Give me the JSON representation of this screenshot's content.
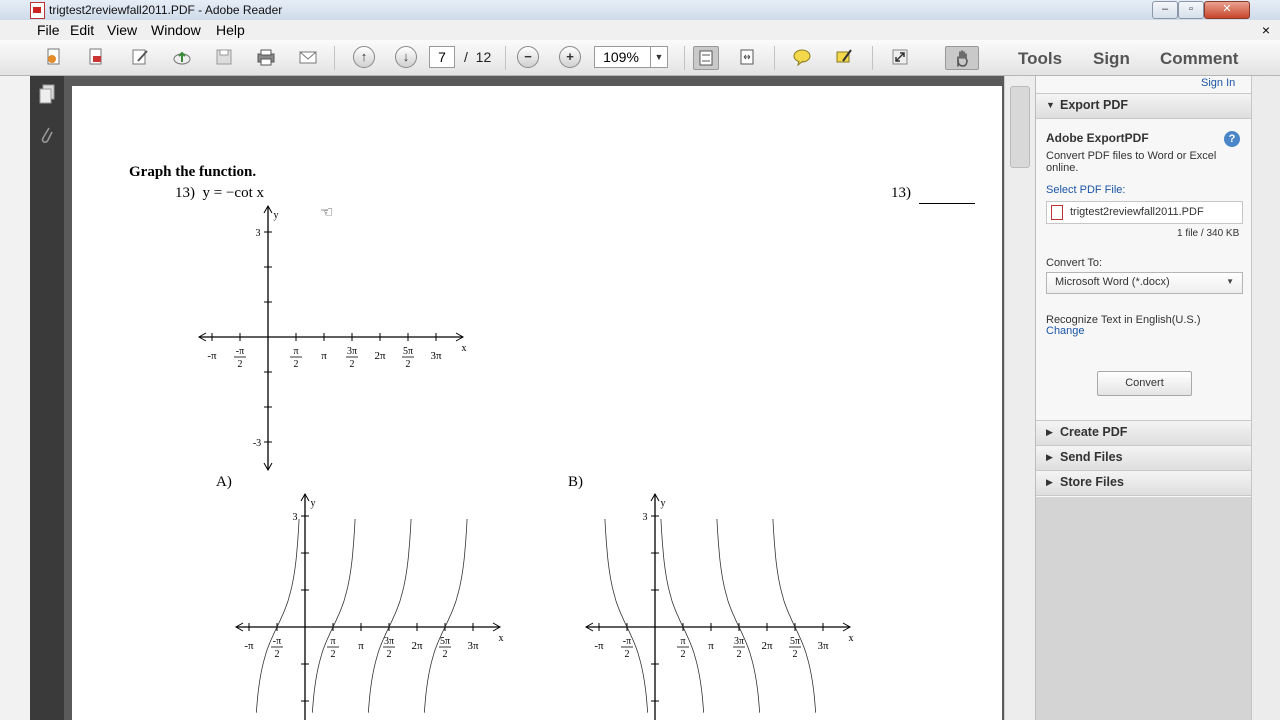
{
  "window": {
    "title": "trigtest2reviewfall2011.PDF - Adobe Reader"
  },
  "menu": {
    "items": [
      "File",
      "Edit",
      "View",
      "Window",
      "Help"
    ],
    "close_glyph": "×"
  },
  "toolbar": {
    "current_page": "7",
    "page_separator": "/",
    "total_pages": "12",
    "zoom": "109%",
    "tools_label": "Tools",
    "sign_label": "Sign",
    "comment_label": "Comment"
  },
  "document": {
    "heading": "Graph the function.",
    "question_number": "13)",
    "question_expr": "y = −cot x",
    "answer_number": "13)",
    "option_a": "A)",
    "option_b": "B)"
  },
  "axis_labels": {
    "x": "x",
    "y": "y",
    "y_top": "3",
    "y_bottom": "-3",
    "neg_pi": "-π",
    "neg_pi_num": "-π",
    "pi_num": "π",
    "pi": "π",
    "three_pi_num": "3π",
    "two_pi": "2π",
    "five_pi_num": "5π",
    "three_pi": "3π",
    "den": "2"
  },
  "right_panel": {
    "sign_in": "Sign In",
    "export_title": "Export PDF",
    "export_subtitle": "Adobe ExportPDF",
    "export_desc_1": "Convert PDF files to Word or Excel",
    "export_desc_2": "online.",
    "select_file_label": "Select PDF File:",
    "file_name": "trigtest2reviewfall2011.PDF",
    "file_info": "1 file / 340 KB",
    "convert_to_label": "Convert To:",
    "convert_to_value": "Microsoft Word (*.docx)",
    "recognize_text": "Recognize Text in English(U.S.)",
    "change_link": "Change",
    "convert_button": "Convert",
    "sections": [
      "Create PDF",
      "Send Files",
      "Store Files"
    ]
  },
  "colors": {
    "accent": "#1a55a5",
    "doc_background": "#5a5a5a",
    "panel_fill": "#d4d4d4"
  }
}
